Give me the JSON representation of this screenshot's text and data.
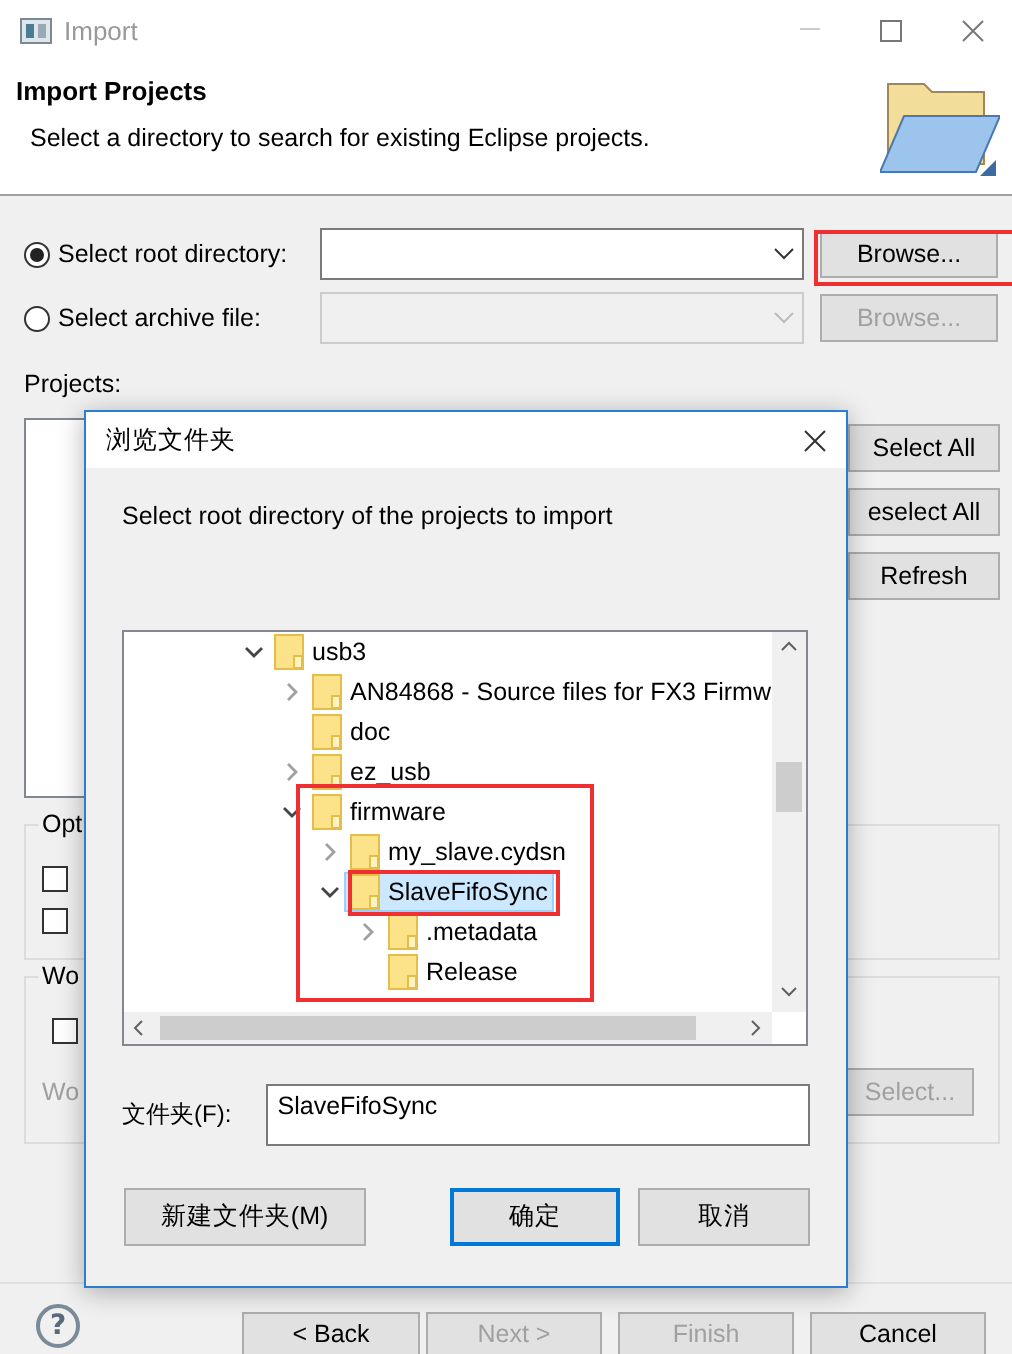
{
  "window": {
    "title": "Import"
  },
  "header": {
    "title": "Import Projects",
    "description": "Select a directory to search for existing Eclipse projects."
  },
  "source_options": [
    {
      "label": "Select root directory:",
      "selected": true,
      "disabled": false,
      "browse": "Browse..."
    },
    {
      "label": "Select archive file:",
      "selected": false,
      "disabled": true,
      "browse": "Browse..."
    }
  ],
  "projects_label": "Projects:",
  "project_buttons": [
    "Select All",
    "eselect All",
    "Refresh"
  ],
  "options_group": {
    "legend": "Opt",
    "checkboxes": [
      {
        "checked": false
      },
      {
        "checked": false
      }
    ]
  },
  "working_sets": {
    "legend": "Wo",
    "checked": false,
    "label": "Wo",
    "disabled": true,
    "select_button": "Select..."
  },
  "footer": {
    "help": "?",
    "buttons": [
      {
        "label": "< Back",
        "disabled": false
      },
      {
        "label": "Next >",
        "disabled": true
      },
      {
        "label": "Finish",
        "disabled": true
      },
      {
        "label": "Cancel",
        "disabled": false
      }
    ]
  },
  "browse_dialog": {
    "title": "浏览文件夹",
    "instruction": "Select root directory of the projects to import",
    "tree": [
      {
        "label": "usb3",
        "expandable": true,
        "expanded": true,
        "selected": false,
        "children": [
          {
            "label": "AN84868 - Source files for FX3 Firmw",
            "expandable": true,
            "expanded": false,
            "selected": false
          },
          {
            "label": "doc",
            "expandable": false,
            "expanded": false,
            "selected": false
          },
          {
            "label": "ez_usb",
            "expandable": true,
            "expanded": false,
            "selected": false
          },
          {
            "label": "firmware",
            "expandable": true,
            "expanded": true,
            "selected": false,
            "children": [
              {
                "label": "my_slave.cydsn",
                "expandable": true,
                "expanded": false,
                "selected": false
              },
              {
                "label": "SlaveFifoSync",
                "expandable": true,
                "expanded": true,
                "selected": true,
                "children": [
                  {
                    "label": ".metadata",
                    "expandable": true,
                    "expanded": false,
                    "selected": false
                  },
                  {
                    "label": "Release",
                    "expandable": false,
                    "expanded": false,
                    "selected": false
                  }
                ]
              }
            ]
          }
        ]
      }
    ],
    "folder_label": "文件夹(F):",
    "folder_value": "SlaveFifoSync",
    "buttons": [
      {
        "label": "新建文件夹(M)",
        "default": false
      },
      {
        "label": "确定",
        "default": true
      },
      {
        "label": "取消",
        "default": false
      }
    ]
  }
}
